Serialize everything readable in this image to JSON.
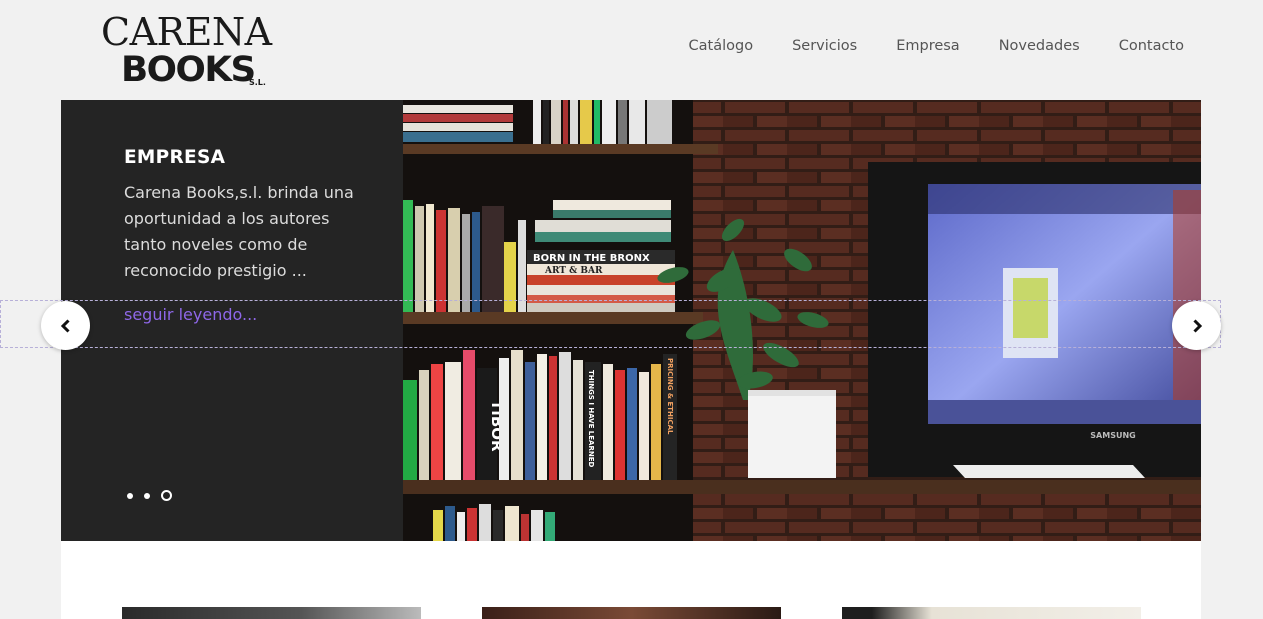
{
  "logo": {
    "line1": "CARENA",
    "line2": "BOOKS",
    "suffix": "S.L."
  },
  "nav": [
    {
      "label": "Catálogo"
    },
    {
      "label": "Servicios"
    },
    {
      "label": "Empresa"
    },
    {
      "label": "Novedades"
    },
    {
      "label": "Contacto"
    }
  ],
  "slide": {
    "title": "EMPRESA",
    "text": "Carena Books,s.l. brinda una oportunidad a los autores tanto noveles como de reconocido prestigio ...",
    "link": "seguir leyendo...",
    "dots_total": 3,
    "dots_active_index": 2,
    "monitor_brand": "SAMSUNG",
    "book_spines": {
      "a": "BORN IN THE BRONX",
      "b": "ART & BAR",
      "c": "TIBOR",
      "d": "THINGS I HAVE LEARNED",
      "e": "PRICING & ETHICAL"
    }
  },
  "colors": {
    "accent": "#8e67e8",
    "panel_bg": "#242424",
    "page_bg": "#f1f1f1"
  },
  "icons": {
    "prev": "chevron-left-icon",
    "next": "chevron-right-icon"
  }
}
